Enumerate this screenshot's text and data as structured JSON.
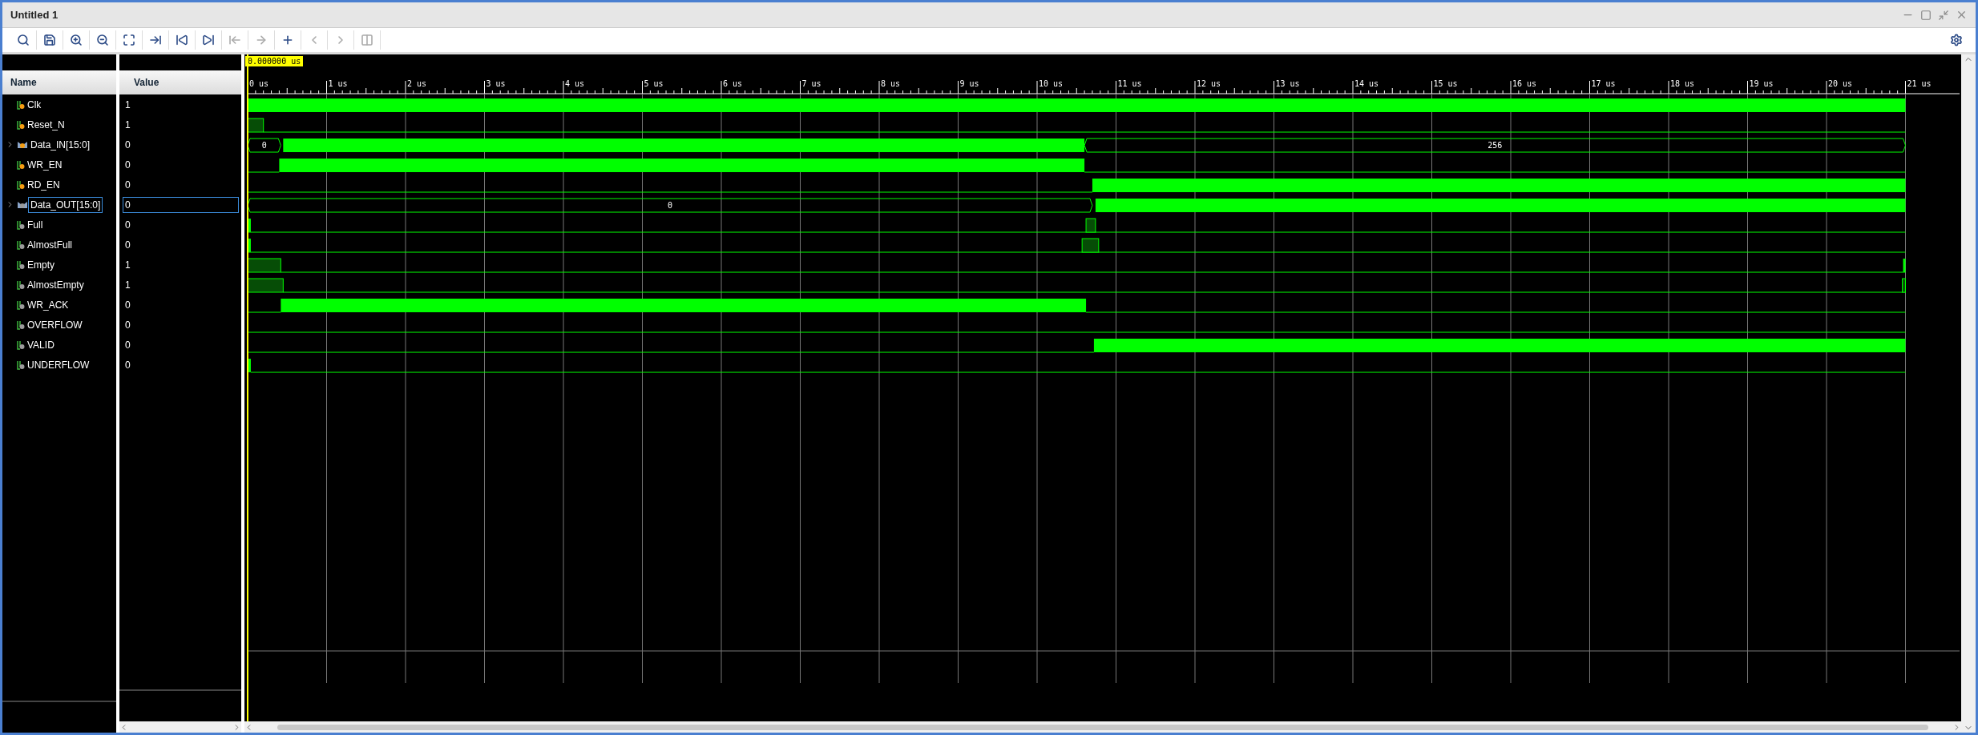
{
  "window": {
    "title": "Untitled 1"
  },
  "toolbar": [
    {
      "disabled": false
    },
    {
      "disabled": false
    },
    {
      "disabled": false
    },
    {
      "disabled": false
    },
    {
      "disabled": false
    },
    {
      "disabled": false
    },
    {
      "disabled": false
    },
    {
      "disabled": false
    },
    {
      "disabled": true
    },
    {
      "disabled": true
    },
    {
      "disabled": false
    },
    {
      "disabled": true
    },
    {
      "disabled": true
    },
    {
      "disabled": true
    }
  ],
  "columns": {
    "name": "Name",
    "value": "Value"
  },
  "cursor": {
    "time": "0.000000 us"
  },
  "ruler": [
    "0 us",
    "1 us",
    "2 us",
    "3 us",
    "4 us",
    "5 us",
    "6 us",
    "7 us",
    "8 us",
    "9 us",
    "10 us",
    "11 us",
    "12 us",
    "13 us",
    "14 us",
    "15 us",
    "16 us",
    "17 us",
    "18 us",
    "19 us",
    "20 us",
    "21 us"
  ],
  "signals": [
    {
      "name": "Clk",
      "value": "1",
      "kind": "bit",
      "is_input": true,
      "selected": false
    },
    {
      "name": "Reset_N",
      "value": "1",
      "kind": "bit",
      "is_input": true,
      "selected": false
    },
    {
      "name": "Data_IN[15:0]",
      "value": "0",
      "kind": "bus",
      "is_input": true,
      "selected": false,
      "expanded": false,
      "bus_values": [
        "0",
        "256"
      ]
    },
    {
      "name": "WR_EN",
      "value": "0",
      "kind": "bit",
      "is_input": true,
      "selected": false
    },
    {
      "name": "RD_EN",
      "value": "0",
      "kind": "bit",
      "is_input": true,
      "selected": false
    },
    {
      "name": "Data_OUT[15:0]",
      "value": "0",
      "kind": "bus",
      "is_input": false,
      "selected": true,
      "expanded": false,
      "bus_values": [
        "0"
      ]
    },
    {
      "name": "Full",
      "value": "0",
      "kind": "bit",
      "is_input": false,
      "selected": false
    },
    {
      "name": "AlmostFull",
      "value": "0",
      "kind": "bit",
      "is_input": false,
      "selected": false
    },
    {
      "name": "Empty",
      "value": "1",
      "kind": "bit",
      "is_input": false,
      "selected": false
    },
    {
      "name": "AlmostEmpty",
      "value": "1",
      "kind": "bit",
      "is_input": false,
      "selected": false
    },
    {
      "name": "WR_ACK",
      "value": "0",
      "kind": "bit",
      "is_input": false,
      "selected": false
    },
    {
      "name": "OVERFLOW",
      "value": "0",
      "kind": "bit",
      "is_input": false,
      "selected": false
    },
    {
      "name": "VALID",
      "value": "0",
      "kind": "bit",
      "is_input": false,
      "selected": false
    },
    {
      "name": "UNDERFLOW",
      "value": "0",
      "kind": "bit",
      "is_input": false,
      "selected": false
    }
  ]
}
